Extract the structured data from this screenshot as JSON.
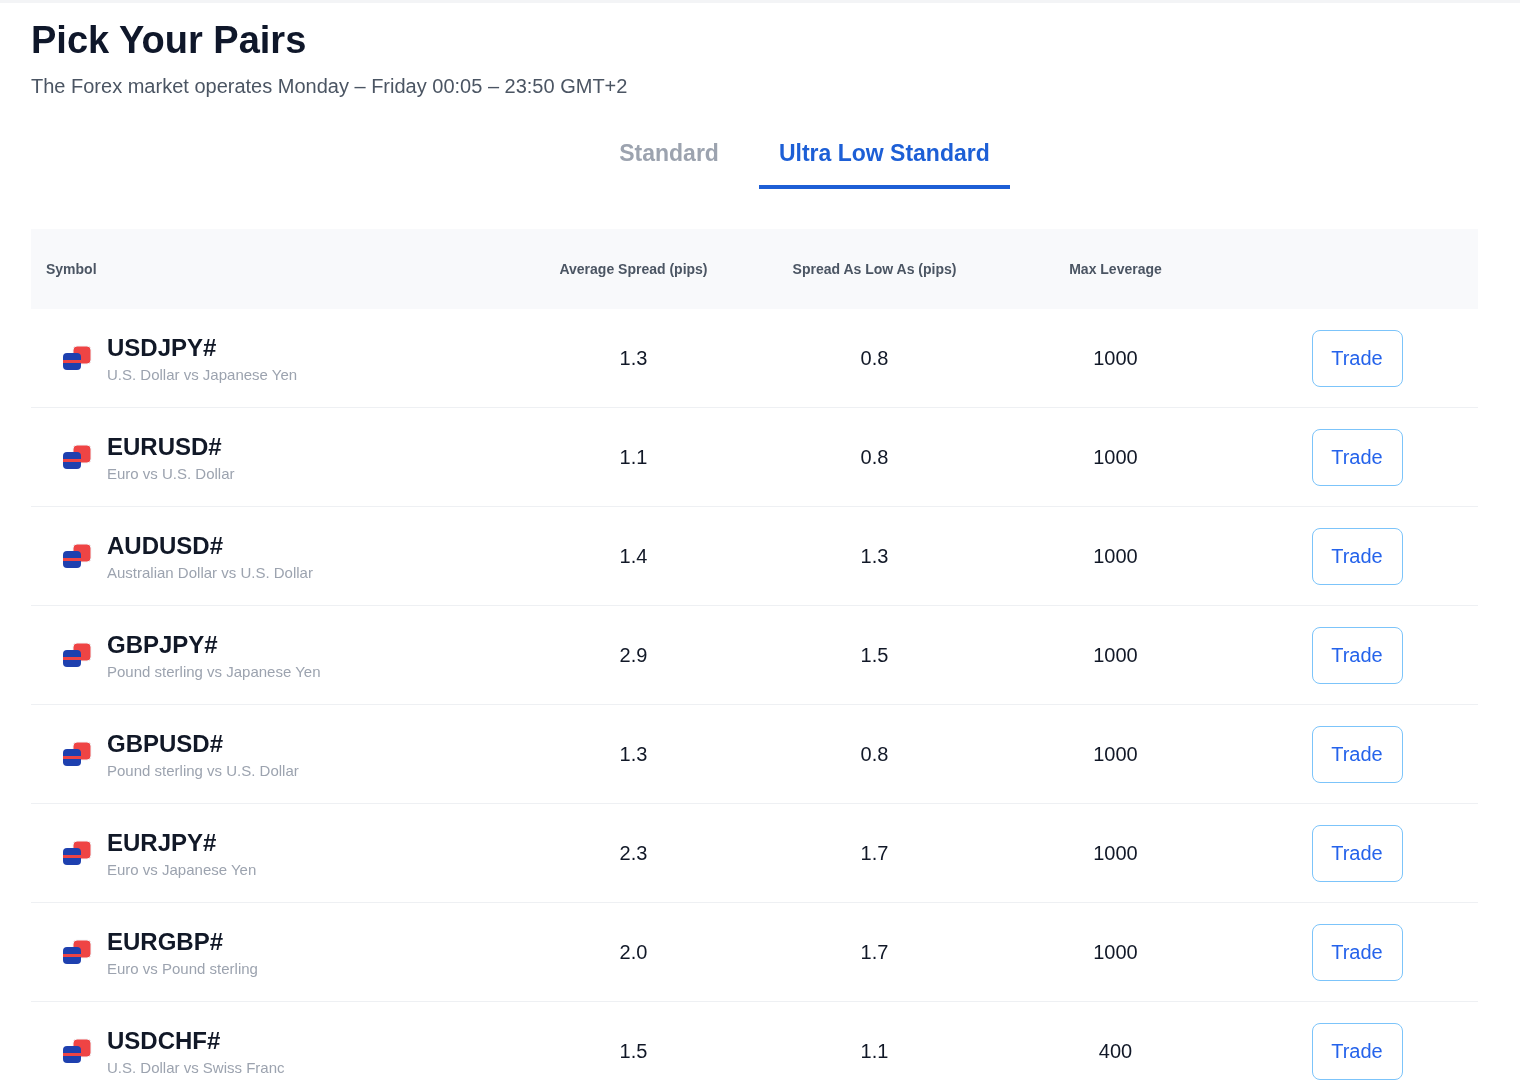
{
  "title": "Pick Your Pairs",
  "subtitle": "The Forex market operates Monday – Friday 00:05 – 23:50 GMT+2",
  "tabs": [
    {
      "label": "Standard",
      "selected": false
    },
    {
      "label": "Ultra Low Standard",
      "selected": true
    }
  ],
  "table": {
    "columns": [
      "Symbol",
      "Average Spread (pips)",
      "Spread As Low As (pips)",
      "Max Leverage"
    ],
    "rows": [
      {
        "symbol": "USDJPY#",
        "name": "U.S. Dollar vs Japanese Yen",
        "average_spread": "1.3",
        "spread_low": "0.8",
        "max_leverage": "1000",
        "action": "Trade"
      },
      {
        "symbol": "EURUSD#",
        "name": "Euro vs U.S. Dollar",
        "average_spread": "1.1",
        "spread_low": "0.8",
        "max_leverage": "1000",
        "action": "Trade"
      },
      {
        "symbol": "AUDUSD#",
        "name": "Australian Dollar vs U.S. Dollar",
        "average_spread": "1.4",
        "spread_low": "1.3",
        "max_leverage": "1000",
        "action": "Trade"
      },
      {
        "symbol": "GBPJPY#",
        "name": "Pound sterling vs Japanese Yen",
        "average_spread": "2.9",
        "spread_low": "1.5",
        "max_leverage": "1000",
        "action": "Trade"
      },
      {
        "symbol": "GBPUSD#",
        "name": "Pound sterling vs U.S. Dollar",
        "average_spread": "1.3",
        "spread_low": "0.8",
        "max_leverage": "1000",
        "action": "Trade"
      },
      {
        "symbol": "EURJPY#",
        "name": "Euro vs Japanese Yen",
        "average_spread": "2.3",
        "spread_low": "1.7",
        "max_leverage": "1000",
        "action": "Trade"
      },
      {
        "symbol": "EURGBP#",
        "name": "Euro vs Pound sterling",
        "average_spread": "2.0",
        "spread_low": "1.7",
        "max_leverage": "1000",
        "action": "Trade"
      },
      {
        "symbol": "USDCHF#",
        "name": "U.S. Dollar vs Swiss Franc",
        "average_spread": "1.5",
        "spread_low": "1.1",
        "max_leverage": "400",
        "action": "Trade"
      }
    ]
  }
}
